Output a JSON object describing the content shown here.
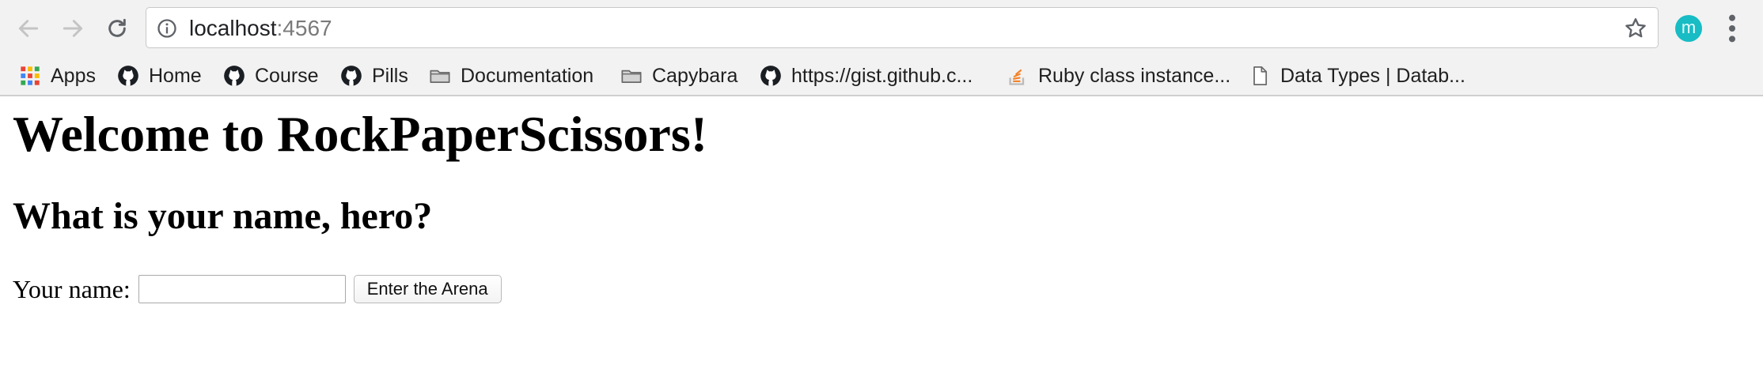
{
  "browser": {
    "url_host": "localhost",
    "url_port": ":4567",
    "profile_initial": "m",
    "bookmarks": [
      {
        "label": "Apps",
        "icon": "apps-grid-icon"
      },
      {
        "label": "Home",
        "icon": "github-icon"
      },
      {
        "label": "Course",
        "icon": "github-icon"
      },
      {
        "label": "Pills",
        "icon": "github-icon"
      },
      {
        "label": "Documentation",
        "icon": "folder-icon"
      },
      {
        "label": "Capybara",
        "icon": "folder-icon"
      },
      {
        "label": "https://gist.github.c...",
        "icon": "github-icon"
      },
      {
        "label": "Ruby class instance...",
        "icon": "stackoverflow-icon"
      },
      {
        "label": "Data Types | Datab...",
        "icon": "document-icon"
      }
    ]
  },
  "page": {
    "title": "Welcome to RockPaperScissors!",
    "subtitle": "What is your name, hero?",
    "form": {
      "label": "Your name:",
      "input_value": "",
      "submit_label": "Enter the Arena"
    }
  },
  "colors": {
    "avatar": "#18bcc4",
    "stackoverflow": "#f48024"
  }
}
